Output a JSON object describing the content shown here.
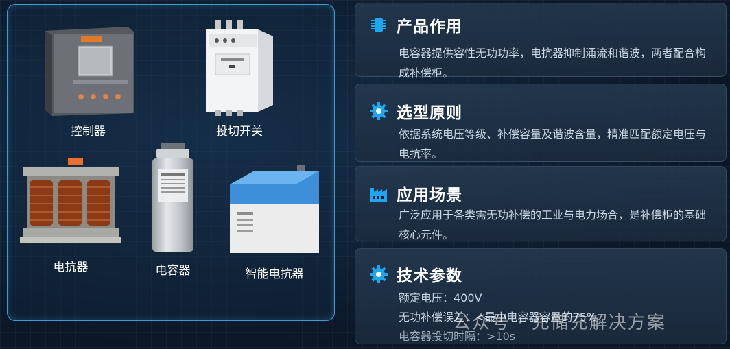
{
  "products": [
    {
      "name": "控制器"
    },
    {
      "name": "投切开关"
    },
    {
      "name": "电抗器"
    },
    {
      "name": "电容器"
    },
    {
      "name": "智能电抗器"
    }
  ],
  "cards": [
    {
      "title": "产品作用",
      "icon": "chip-icon",
      "body": "电容器提供容性无功功率，电抗器抑制涌流和谐波，两者配合构成补偿柜。"
    },
    {
      "title": "选型原则",
      "icon": "gear-icon",
      "body": "依据系统电压等级、补偿容量及谐波含量，精准匹配额定电压与电抗率。"
    },
    {
      "title": "应用场景",
      "icon": "factory-icon",
      "body": "广泛应用于各类需无功补偿的工业与电力场合，是补偿柜的基础核心元件。"
    },
    {
      "title": "技术参数",
      "icon": "gear-icon",
      "lines": [
        "额定电压：400V",
        "无功补偿误差：<最小电容器容量的75%",
        "电容器投切时隔：>10s"
      ]
    }
  ],
  "watermark": "公众号 · 充储充解决方案",
  "colors": {
    "accent": "#1ea7f0",
    "frame": "#3d9bd6",
    "bg": "#0c1a2b"
  }
}
